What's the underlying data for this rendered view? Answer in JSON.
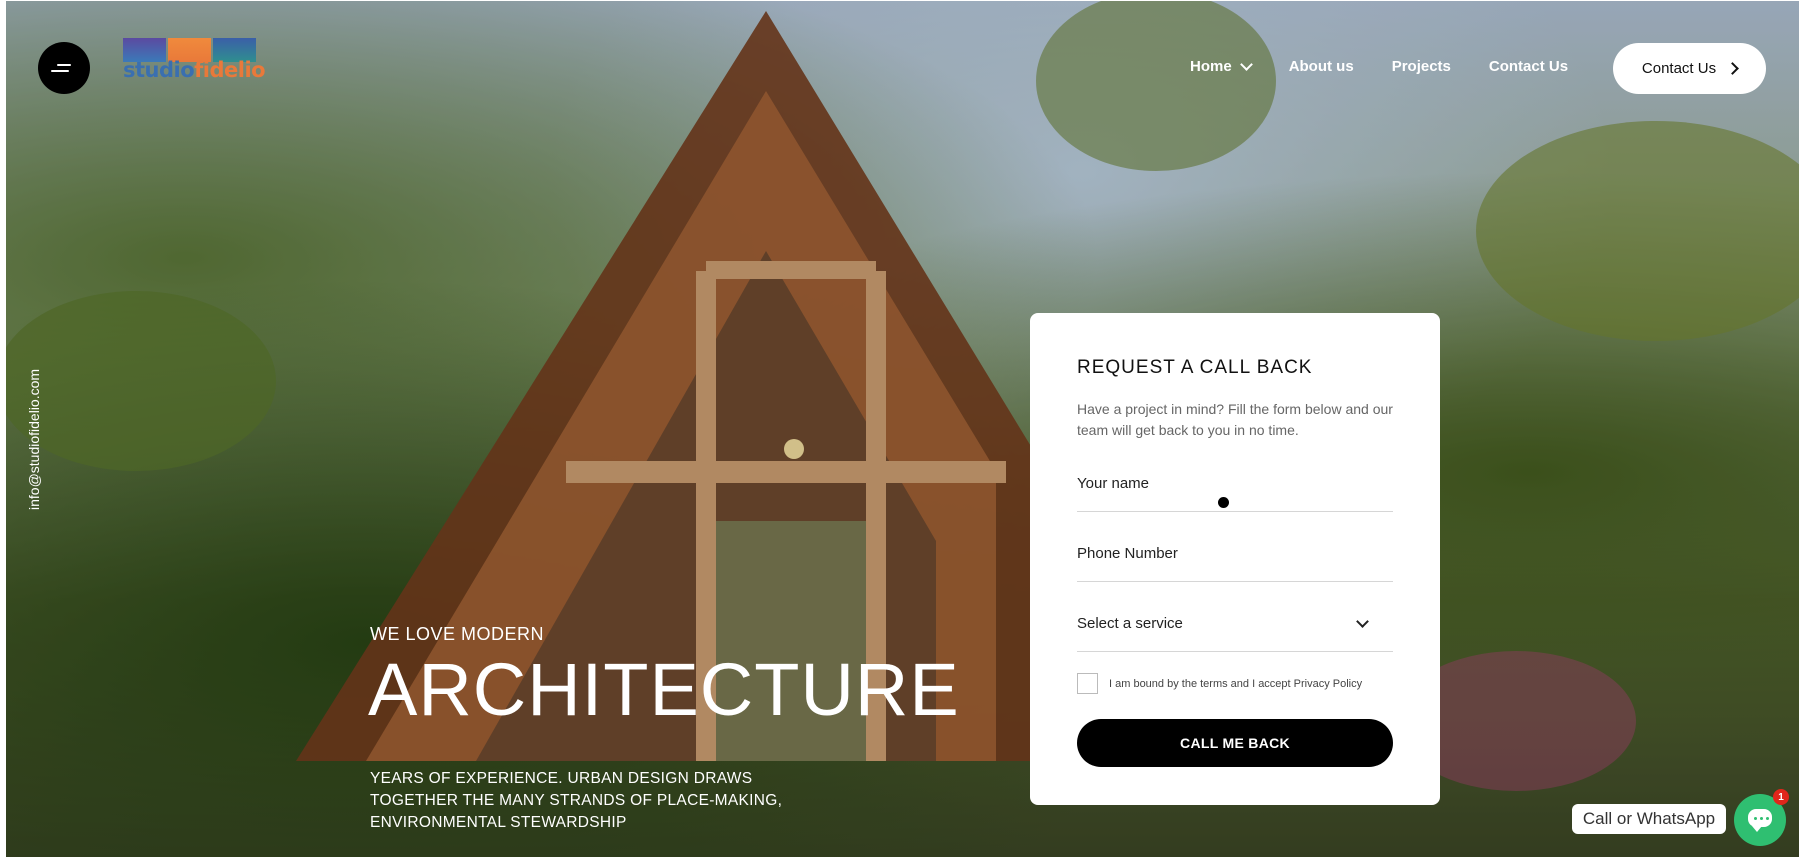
{
  "brand": {
    "logo_part1": "studio",
    "logo_part2": "fidelio",
    "logo_colors": [
      "#6b56a8",
      "#e9793a",
      "#3a6fb0"
    ]
  },
  "header": {
    "menu_icon": "hamburger-icon",
    "nav": [
      {
        "label": "Home",
        "has_dropdown": true
      },
      {
        "label": "About us"
      },
      {
        "label": "Projects"
      },
      {
        "label": "Contact Us"
      }
    ],
    "cta_label": "Contact Us"
  },
  "side": {
    "email": "info@studiofidelio.com"
  },
  "hero": {
    "kicker": "WE LOVE MODERN",
    "title": "ARCHITECTURE",
    "description_lines": [
      "YEARS OF EXPERIENCE. URBAN DESIGN DRAWS",
      "TOGETHER THE MANY STRANDS OF PLACE-MAKING,",
      "ENVIRONMENTAL STEWARDSHIP"
    ]
  },
  "form": {
    "title": "REQUEST A CALL BACK",
    "subtitle": "Have a project in mind? Fill the form below and our team will get back to you in no time.",
    "name_placeholder": "Your name",
    "phone_placeholder": "Phone Number",
    "service_placeholder": "Select a service",
    "consent_text": "I am bound by the terms and I accept Privacy Policy",
    "consent_checked": false,
    "submit_label": "CALL ME BACK"
  },
  "chat_widget": {
    "label": "Call or WhatsApp",
    "badge_count": "1",
    "icon": "chat-bubble-icon",
    "color": "#2fbf71"
  }
}
